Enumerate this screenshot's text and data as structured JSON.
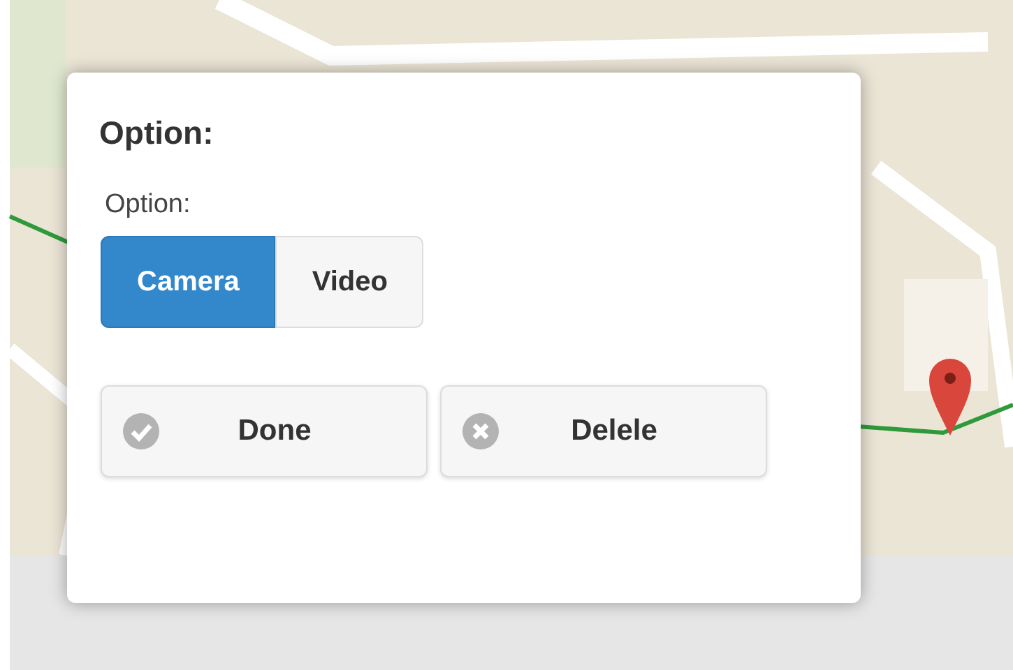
{
  "dialog": {
    "title": "Option:",
    "field_label": "Option:",
    "options": [
      {
        "label": "Camera",
        "selected": true
      },
      {
        "label": "Video",
        "selected": false
      }
    ],
    "buttons": [
      {
        "label": "Done",
        "kind": "done"
      },
      {
        "label": "Delele",
        "kind": "delete"
      }
    ]
  }
}
